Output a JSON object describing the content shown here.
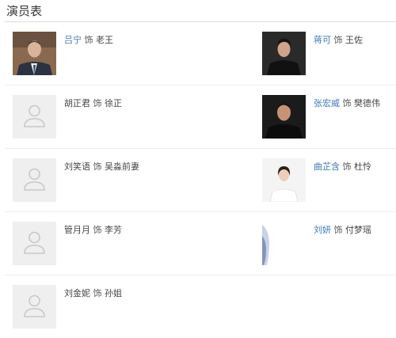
{
  "section_title": "演员表",
  "connector": "饰",
  "cast": [
    {
      "actor": "吕宁",
      "role": "老王",
      "linked": true,
      "photo": "photo"
    },
    {
      "actor": "蒋可",
      "role": "王佐",
      "linked": true,
      "photo": "photo"
    },
    {
      "actor": "胡正君",
      "role": "徐正",
      "linked": false,
      "photo": "placeholder"
    },
    {
      "actor": "张宏威",
      "role": "樊德伟",
      "linked": true,
      "photo": "photo"
    },
    {
      "actor": "刘笑语",
      "role": "吴淼前妻",
      "linked": false,
      "photo": "placeholder"
    },
    {
      "actor": "曲芷含",
      "role": "杜怜",
      "linked": true,
      "photo": "photo"
    },
    {
      "actor": "管月月",
      "role": "李芳",
      "linked": false,
      "photo": "placeholder"
    },
    {
      "actor": "刘妍",
      "role": "付梦瑶",
      "linked": true,
      "photo": "photo-partial"
    },
    {
      "actor": "刘金妮",
      "role": "孙姐",
      "linked": false,
      "photo": "placeholder"
    }
  ]
}
